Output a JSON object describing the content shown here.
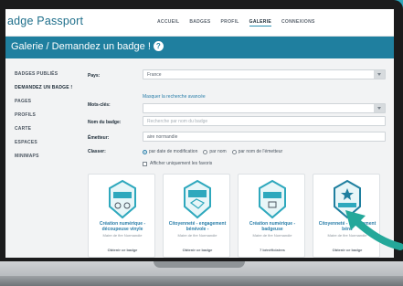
{
  "site": {
    "logo": "adge Passport",
    "nav": [
      "ACCUEIL",
      "BADGES",
      "PROFIL",
      "GALERIE",
      "CONNEXIONS"
    ],
    "nav_active_index": 3
  },
  "page": {
    "title": "Galerie / Demandez un badge !",
    "help_icon": "?"
  },
  "sidebar": {
    "items": [
      {
        "label": "BADGES PUBLIÉS"
      },
      {
        "label": "DEMANDEZ UN BADGE !"
      },
      {
        "label": "PAGES"
      },
      {
        "label": "PROFILS"
      },
      {
        "label": "CARTE"
      },
      {
        "label": "ESPACES"
      },
      {
        "label": "MINIMAPS"
      }
    ],
    "active_index": 1
  },
  "form": {
    "pays_label": "Pays:",
    "pays_value": "France",
    "advanced_link": "Masquer la recherche avancée",
    "keyword_label": "Mots-clés:",
    "keyword_value": "",
    "badge_name_label": "Nom du badge:",
    "badge_name_placeholder": "Recherche par nom du badge",
    "issuer_label": "Émetteur:",
    "issuer_value": "aire normandie",
    "sort_label": "Classer:",
    "sort_options": [
      "par date de modification",
      "par nom",
      "par nom de l'émetteur"
    ],
    "sort_selected_index": 0,
    "favorites_label": "Afficher uniquement les favoris"
  },
  "cards": [
    {
      "title": "Création numérique - découpeuse vinyle",
      "issuer": "Maire de fire Normandie",
      "footer": "Obtenir ce badge",
      "accent": "#2ea8bd"
    },
    {
      "title": "Citoyenneté - engagement bénévole -",
      "issuer": "Maire de fire Normandie",
      "footer": "Obtenir ce badge",
      "accent": "#2ea8bd"
    },
    {
      "title": "Création numérique - badgeuse",
      "issuer": "Maire de fire Normandie",
      "footer": "7 bénéficiaires",
      "accent": "#2ea8bd"
    },
    {
      "title": "Citoyenneté - engagement béné",
      "issuer": "Maire de fire Normandie",
      "footer": "Obtenir ce badge",
      "accent": "#2ea8bd"
    }
  ],
  "colors": {
    "background": "#2ea8bd",
    "titlebar": "#1f7f9f",
    "link": "#2a7ea9",
    "arrow": "#24a89a"
  }
}
